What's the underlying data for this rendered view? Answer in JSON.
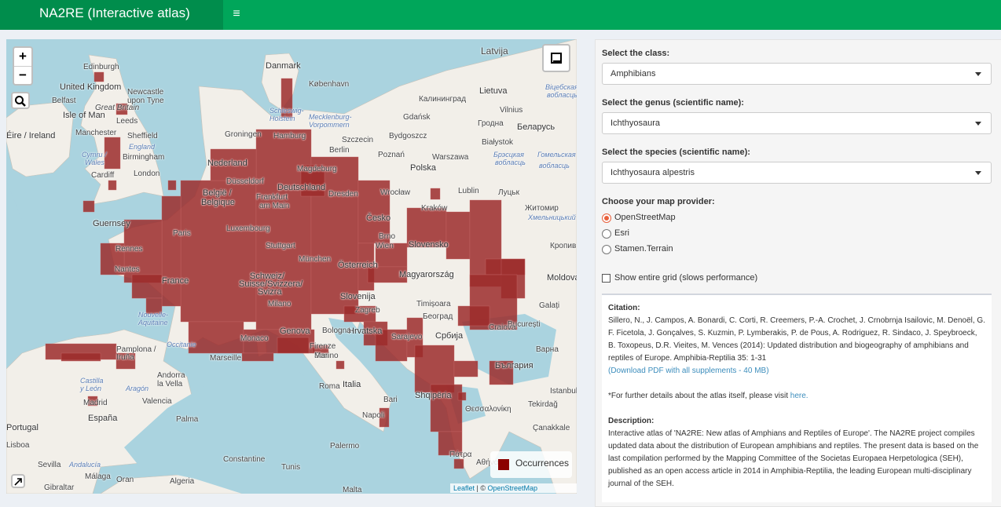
{
  "header": {
    "title": "NA2RE (Interactive atlas)",
    "menu_icon": "hamburger-icon"
  },
  "map": {
    "zoom_in": "+",
    "zoom_out": "−",
    "legend_label": "Occurrences",
    "legend_color": "#8b0000",
    "attribution": {
      "leaflet": "Leaflet",
      "sep": " | © ",
      "osm": "OpenStreetMap",
      "contributors": " contributors"
    },
    "labels": [
      "Latvija",
      "Edinburgh",
      "United Kingdom",
      "Newcastle upon Tyne",
      "Belfast",
      "Great Britain",
      "Isle of Man",
      "Danmark",
      "København",
      "Калининград",
      "Lietuva",
      "Manchester",
      "Leeds",
      "Sheffield",
      "Éire / Ireland",
      "England",
      "Cymru / Wales",
      "Birmingham",
      "Gdańsk",
      "Vilnius",
      "Гродна",
      "Беларусь",
      "Groningen",
      "Hamburg",
      "Schleswig-Holstein",
      "Mecklenburg-Vorpommern",
      "Szczecin",
      "Bydgoszcz",
      "Białystok",
      "Cardiff",
      "London",
      "Nederland",
      "Berlin",
      "Poznań",
      "Warszawa",
      "Polska",
      "Брэсцкая вобласць",
      "Magdeburg",
      "Düsseldorf",
      "Deutschland",
      "Dresden",
      "Wrocław",
      "Lublin",
      "Луцьк",
      "Frankfurt am Main",
      "Kraków",
      "Житомир",
      "België / Belgique",
      "Guernsey",
      "Paris",
      "Luxembourg",
      "Česko",
      "Хмельницький",
      "Rennes",
      "Stuttgart",
      "Brno",
      "Wien",
      "Slovensko",
      "Кропив",
      "France",
      "München",
      "Österreich",
      "Nantes",
      "Schweiz/Suisse/Svizzera",
      "Magyarország",
      "Molдова",
      "Svizra",
      "Slovenija",
      "Timișoara",
      "Galați",
      "Nouvelle-Aquitaine",
      "Milano",
      "Zagreb",
      "Bucureşti",
      "Београд",
      "Hrvatska",
      "Bologna",
      "Crnaja",
      "Occitanie",
      "Monaco",
      "Firenze",
      "Pamplona / Iruña",
      "Marseille",
      "Sarajevo",
      "Србија",
      "Варна",
      "Genova",
      "San Marino",
      "Andorra la Vella",
      "Roma",
      "Italia",
      "Castilla y León",
      "Aragón",
      "България",
      "Istanbul",
      "Madrid",
      "Shqipëria",
      "España",
      "Valencia",
      "Napoli",
      "Bari",
      "Tekirdağ",
      "Palma",
      "Θεσσαλονίκη",
      "Portugal",
      "Lisboa",
      "Çanakkale",
      "Palermo",
      "Sevilla",
      "Andalucía",
      "Constantine",
      "Málaga",
      "Algeria",
      "Tunis",
      "Αθήνα",
      "Πάτρα",
      "Gibraltar",
      "Oran",
      "Malta",
      "Moldova"
    ]
  },
  "controls": {
    "class_label": "Select the class:",
    "class_value": "Amphibians",
    "genus_label": "Select the genus (scientific name):",
    "genus_value": "Ichthyosaura",
    "species_label": "Select the species (scientific name):",
    "species_value": "Ichthyosaura alpestris",
    "provider_label": "Choose your map provider:",
    "providers": [
      {
        "label": "OpenStreetMap",
        "selected": true
      },
      {
        "label": "Esri",
        "selected": false
      },
      {
        "label": "Stamen.Terrain",
        "selected": false
      }
    ],
    "grid_checkbox_label": "Show entire grid (slows performance)",
    "grid_checked": false
  },
  "info": {
    "citation_heading": "Citation:",
    "citation_text": "Sillero, N., J. Campos, A. Bonardi, C. Corti, R. Creemers, P.-A. Crochet, J. Crnobrnja Isailovic, M. Denoël, G. F. Ficetola, J. Gonçalves, S. Kuzmin, P. Lymberakis, P. de Pous, A. Rodriguez, R. Sindaco, J. Speybroeck, B. Toxopeus, D.R. Vieites, M. Vences (2014): Updated distribution and biogeography of amphibians and reptiles of Europe. Amphibia-Reptilia 35: 1-31",
    "download_link": "(Download PDF with all supplements - 40 MB)",
    "further_text": "*For further details about the atlas itself, please visit",
    "further_link": "here.",
    "description_heading": "Description:",
    "description_text": "Interactive atlas of 'NA2RE: New atlas of Amphians and Reptiles of Europe'. The NA2RE project compiles updated data about the distribution of European amphibians and reptiles. The present data is based on the last compilation performed by the Mapping Committee of the Societas Europaea Herpetologica (SEH), published as an open access article in 2014 in Amphibia-Reptilia, the leading European multi-disciplinary journal of the SEH."
  }
}
